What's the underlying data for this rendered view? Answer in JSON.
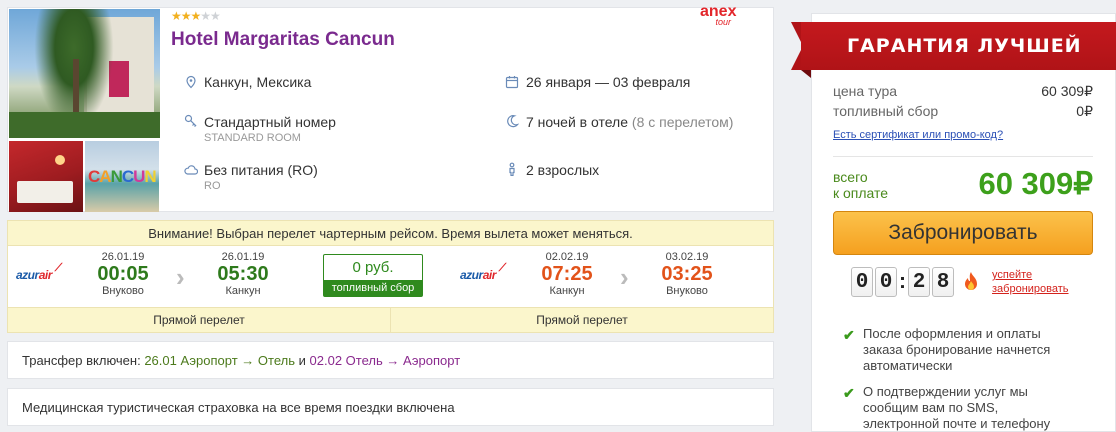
{
  "hotel": {
    "stars_on": "★★★",
    "stars_off": "★★",
    "name": "Hotel Margaritas Cancun",
    "operator_logo_top": "anex",
    "operator_logo_bottom": "tour",
    "location": "Канкун, Мексика",
    "dates": "26 января — 03 февраля",
    "room": "Стандартный номер",
    "room_sub": "STANDARD ROOM",
    "nights": "7 ночей в отеле",
    "nights_extra": "(8 с перелетом)",
    "meal": "Без питания (RO)",
    "meal_sub": "RO",
    "guests": "2 взрослых",
    "photo_word": "CANCUN"
  },
  "flight": {
    "warning": "Внимание! Выбран перелет чартерным рейсом. Время вылета может меняться.",
    "airline_a": "azur",
    "airline_b": "air",
    "outbound": {
      "dep_date": "26.01.19",
      "dep_time": "00:05",
      "dep_place": "Внуково",
      "arr_date": "26.01.19",
      "arr_time": "05:30",
      "arr_place": "Канкун"
    },
    "return": {
      "dep_date": "02.02.19",
      "dep_time": "07:25",
      "dep_place": "Канкун",
      "arr_date": "03.02.19",
      "arr_time": "03:25",
      "arr_place": "Внуково"
    },
    "fuel_value": "0 руб.",
    "fuel_label": "топливный сбор",
    "direct_out": "Прямой перелет",
    "direct_back": "Прямой перелет"
  },
  "transfer": {
    "prefix": "Трансфер включен:",
    "leg1": "26.01 Аэропорт → Отель",
    "and": "и",
    "leg2": "02.02 Отель → Аэропорт"
  },
  "insurance": "Медицинская туристическая страховка на все время поездки включена",
  "price": {
    "banner": "ГАРАНТИЯ ЛУЧШЕЙ ЦЕНЫ",
    "tour_label": "цена тура",
    "tour_value": "60 309₽",
    "fuel_label": "топливный сбор",
    "fuel_value": "0₽",
    "promo_link": "Есть сертификат или промо-код?",
    "total_label_1": "всего",
    "total_label_2": "к оплате",
    "total_value": "60 309₽",
    "book_button": "Забронировать",
    "timer_d1": "0",
    "timer_d2": "0",
    "timer_colon": ":",
    "timer_d3": "2",
    "timer_d4": "8",
    "hurry_1": "успейте",
    "hurry_2": "забронировать",
    "note1": "После оформления и оплаты заказа бронирование начнется автоматически",
    "note2": "О подтверждении услуг мы сообщим вам по SMS, электронной почте и телефону"
  },
  "colors": {
    "accent_purple": "#7a2a8e",
    "price_green": "#3da01b",
    "banner_red": "#c4191e",
    "button_orange": "#f5a01f"
  }
}
